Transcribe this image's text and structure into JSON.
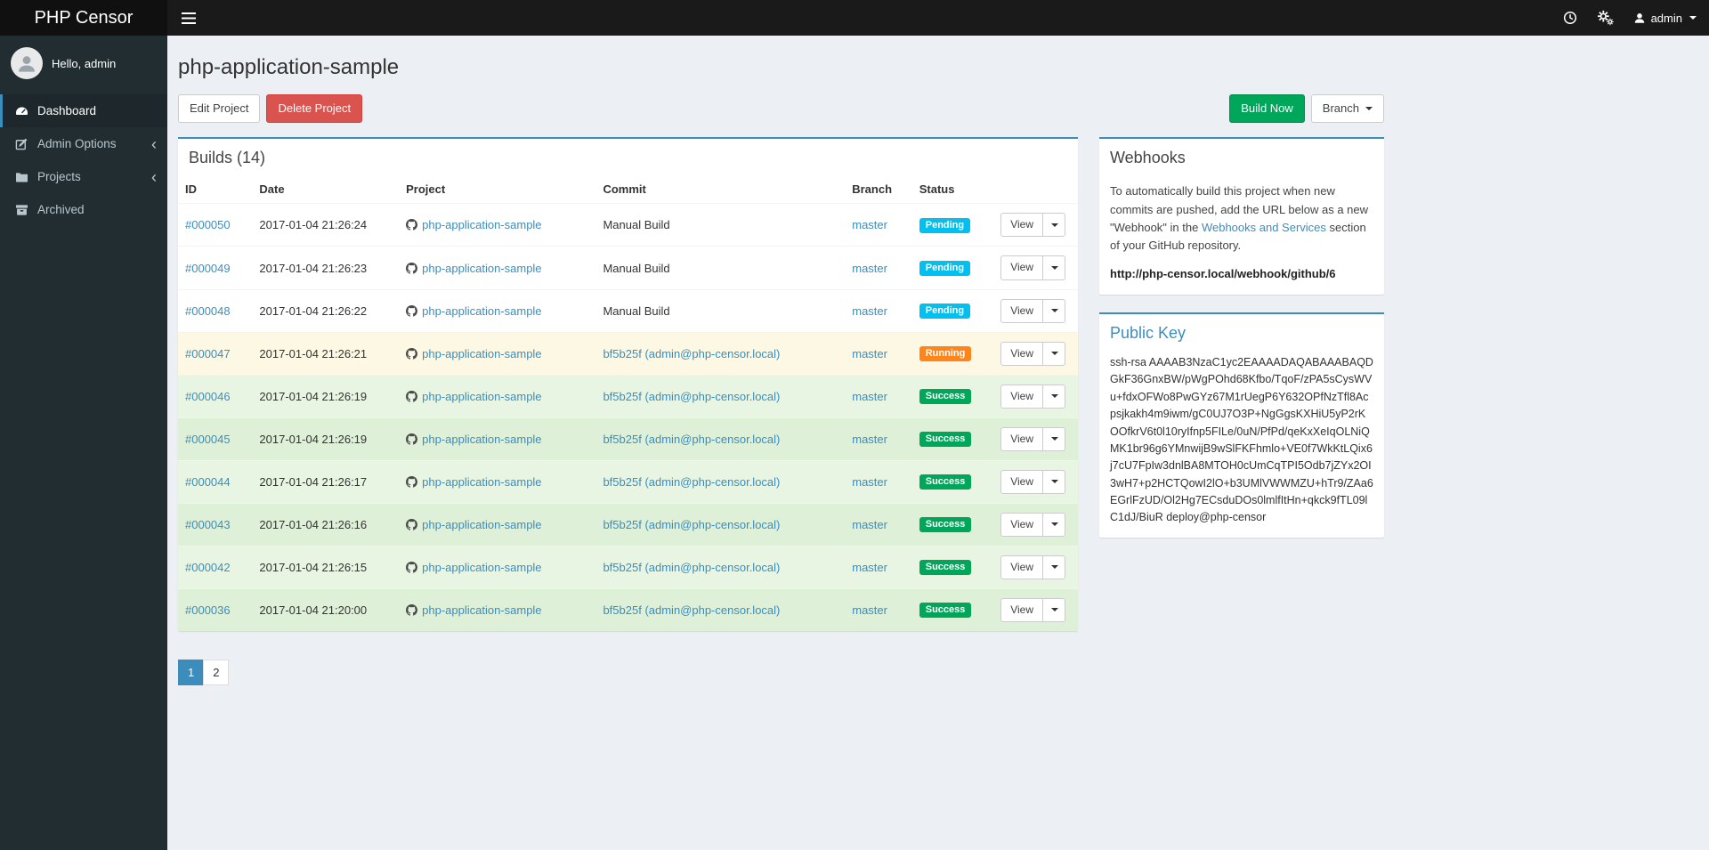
{
  "app": {
    "name": "PHP Censor"
  },
  "navbar": {
    "user": "admin"
  },
  "sidebar": {
    "greeting": "Hello, admin",
    "items": [
      {
        "label": "Dashboard"
      },
      {
        "label": "Admin Options"
      },
      {
        "label": "Projects"
      },
      {
        "label": "Archived"
      }
    ]
  },
  "page": {
    "title": "php-application-sample",
    "edit_project": "Edit Project",
    "delete_project": "Delete Project",
    "build_now": "Build Now",
    "branch": "Branch"
  },
  "builds": {
    "title": "Builds (14)",
    "columns": {
      "id": "ID",
      "date": "Date",
      "project": "Project",
      "commit": "Commit",
      "branch": "Branch",
      "status": "Status"
    },
    "view_label": "View",
    "rows": [
      {
        "id": "#000050",
        "date": "2017-01-04 21:26:24",
        "project": "php-application-sample",
        "commit": "Manual Build",
        "commit_link": false,
        "branch": "master",
        "status": "Pending"
      },
      {
        "id": "#000049",
        "date": "2017-01-04 21:26:23",
        "project": "php-application-sample",
        "commit": "Manual Build",
        "commit_link": false,
        "branch": "master",
        "status": "Pending"
      },
      {
        "id": "#000048",
        "date": "2017-01-04 21:26:22",
        "project": "php-application-sample",
        "commit": "Manual Build",
        "commit_link": false,
        "branch": "master",
        "status": "Pending"
      },
      {
        "id": "#000047",
        "date": "2017-01-04 21:26:21",
        "project": "php-application-sample",
        "commit": "bf5b25f (admin@php-censor.local)",
        "commit_link": true,
        "branch": "master",
        "status": "Running"
      },
      {
        "id": "#000046",
        "date": "2017-01-04 21:26:19",
        "project": "php-application-sample",
        "commit": "bf5b25f (admin@php-censor.local)",
        "commit_link": true,
        "branch": "master",
        "status": "Success"
      },
      {
        "id": "#000045",
        "date": "2017-01-04 21:26:19",
        "project": "php-application-sample",
        "commit": "bf5b25f (admin@php-censor.local)",
        "commit_link": true,
        "branch": "master",
        "status": "Success"
      },
      {
        "id": "#000044",
        "date": "2017-01-04 21:26:17",
        "project": "php-application-sample",
        "commit": "bf5b25f (admin@php-censor.local)",
        "commit_link": true,
        "branch": "master",
        "status": "Success"
      },
      {
        "id": "#000043",
        "date": "2017-01-04 21:26:16",
        "project": "php-application-sample",
        "commit": "bf5b25f (admin@php-censor.local)",
        "commit_link": true,
        "branch": "master",
        "status": "Success"
      },
      {
        "id": "#000042",
        "date": "2017-01-04 21:26:15",
        "project": "php-application-sample",
        "commit": "bf5b25f (admin@php-censor.local)",
        "commit_link": true,
        "branch": "master",
        "status": "Success"
      },
      {
        "id": "#000036",
        "date": "2017-01-04 21:20:00",
        "project": "php-application-sample",
        "commit": "bf5b25f (admin@php-censor.local)",
        "commit_link": true,
        "branch": "master",
        "status": "Success"
      }
    ]
  },
  "pagination": {
    "pages": [
      "1",
      "2"
    ],
    "active": "1"
  },
  "webhooks": {
    "title": "Webhooks",
    "text_before": "To automatically build this project when new commits are pushed, add the URL below as a new \"Webhook\" in the ",
    "link_text": "Webhooks and Services",
    "text_after": " section of your GitHub repository.",
    "url": "http://php-censor.local/webhook/github/6"
  },
  "public_key": {
    "title": "Public Key",
    "key": "ssh-rsa AAAAB3NzaC1yc2EAAAADAQABAAABAQDGkF36GnxBW/pWgPOhd68Kfbo/TqoF/zPA5sCysWVu+fdxOFWo8PwGYz67M1rUegP6Y632OPfNzTfl8Acpsjkakh4m9iwm/gC0UJ7O3P+NgGgsKXHiU5yP2rKOOfkrV6t0l10ryIfnp5FILe/0uN/PfPd/qeKxXeIqOLNiQMK1br96g6YMnwijB9wSlFKFhmlo+VE0f7WkKtLQix6j7cU7FpIw3dnlBA8MTOH0cUmCqTPI5Odb7jZYx2OI3wH7+p2HCTQowI2lO+b3UMlVWWMZU+hTr9/ZAa6EGrlFzUD/Ol2Hg7ECsduDOs0lmlfItHn+qkck9fTL09lC1dJ/BiuR deploy@php-censor"
  },
  "colors": {
    "accent": "#3c8dbc",
    "pending": "#00c0ef",
    "running": "#ff851b",
    "success": "#00a65a",
    "danger": "#d9534f",
    "sidebar_bg": "#222d32",
    "navbar_bg": "#1a1a1a"
  }
}
